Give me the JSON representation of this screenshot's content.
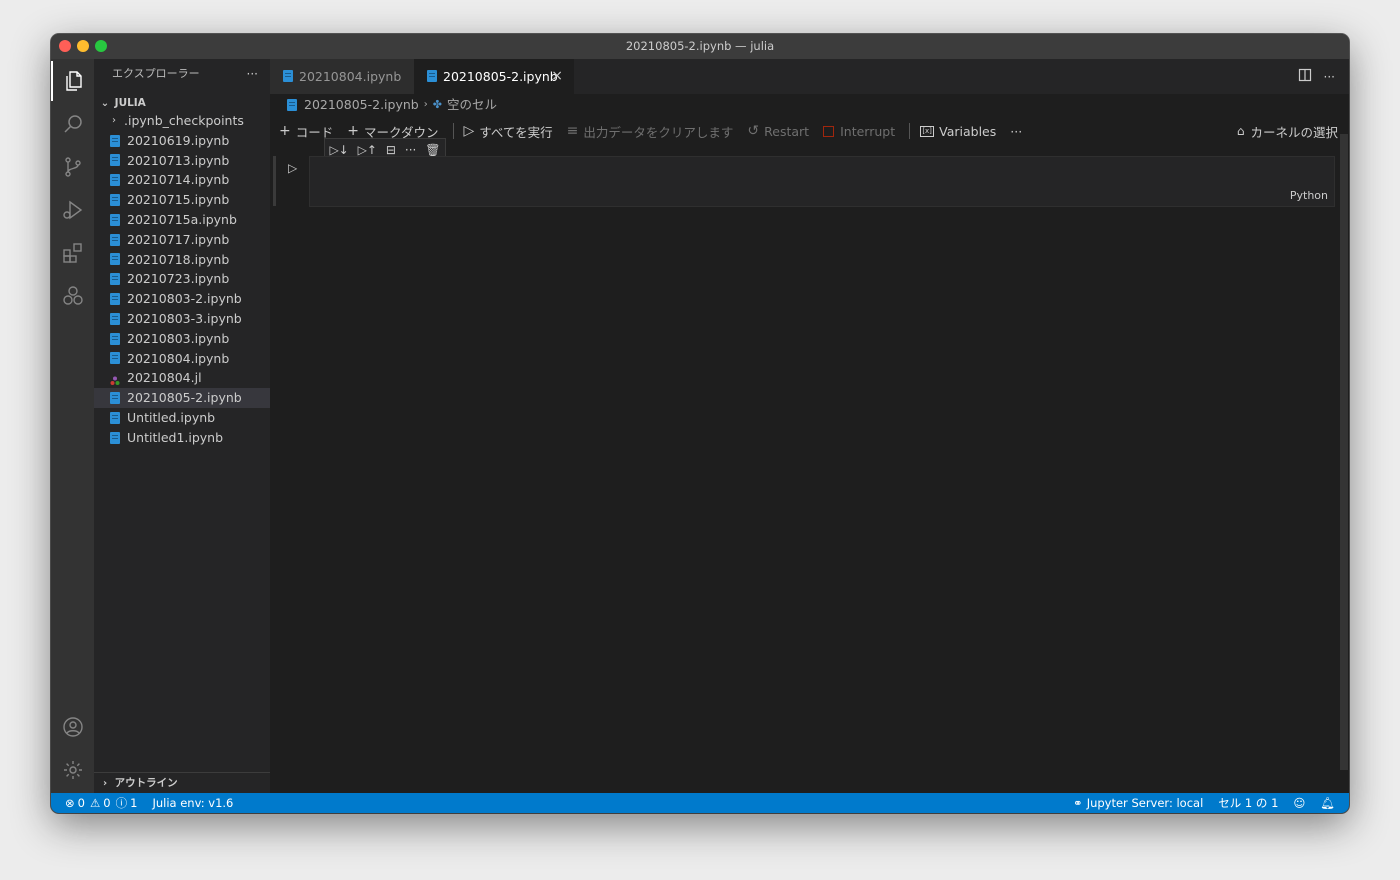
{
  "window": {
    "title": "20210805-2.ipynb — julia"
  },
  "sidebar": {
    "header": "エクスプローラー",
    "more": "···",
    "section": "JULIA",
    "folder": ".ipynb_checkpoints",
    "files": [
      {
        "name": "20210619.ipynb",
        "type": "notebook"
      },
      {
        "name": "20210713.ipynb",
        "type": "notebook"
      },
      {
        "name": "20210714.ipynb",
        "type": "notebook"
      },
      {
        "name": "20210715.ipynb",
        "type": "notebook"
      },
      {
        "name": "20210715a.ipynb",
        "type": "notebook"
      },
      {
        "name": "20210717.ipynb",
        "type": "notebook"
      },
      {
        "name": "20210718.ipynb",
        "type": "notebook"
      },
      {
        "name": "20210723.ipynb",
        "type": "notebook"
      },
      {
        "name": "20210803-2.ipynb",
        "type": "notebook"
      },
      {
        "name": "20210803-3.ipynb",
        "type": "notebook"
      },
      {
        "name": "20210803.ipynb",
        "type": "notebook"
      },
      {
        "name": "20210804.ipynb",
        "type": "notebook"
      },
      {
        "name": "20210804.jl",
        "type": "julia"
      },
      {
        "name": "20210805-2.ipynb",
        "type": "notebook"
      },
      {
        "name": "Untitled.ipynb",
        "type": "notebook"
      },
      {
        "name": "Untitled1.ipynb",
        "type": "notebook"
      }
    ],
    "selected_file": "20210805-2.ipynb",
    "outline": "アウトライン"
  },
  "tabs": [
    {
      "label": "20210804.ipynb"
    },
    {
      "label": "20210805-2.ipynb"
    }
  ],
  "breadcrumb": {
    "file": "20210805-2.ipynb",
    "cell": "空のセル"
  },
  "toolbar": {
    "add_code": "コード",
    "add_markdown": "マークダウン",
    "run_all": "すべてを実行",
    "clear_outputs": "出力データをクリアします",
    "restart": "Restart",
    "interrupt": "Interrupt",
    "variables": "Variables",
    "more": "···",
    "kernel": "カーネルの選択"
  },
  "cell": {
    "language": "Python",
    "toolbar_more": "···"
  },
  "statusbar": {
    "errors": "0",
    "warnings": "0",
    "info": "1",
    "julia_env": "Julia env: v1.6",
    "jupyter": "Jupyter Server: local",
    "cell_position": "セル 1 の 1"
  },
  "colors": {
    "accent": "#007acc",
    "notebook_icon": "#2b8fd6",
    "editor_bg": "#1e1e1e",
    "sidebar_bg": "#252526"
  }
}
